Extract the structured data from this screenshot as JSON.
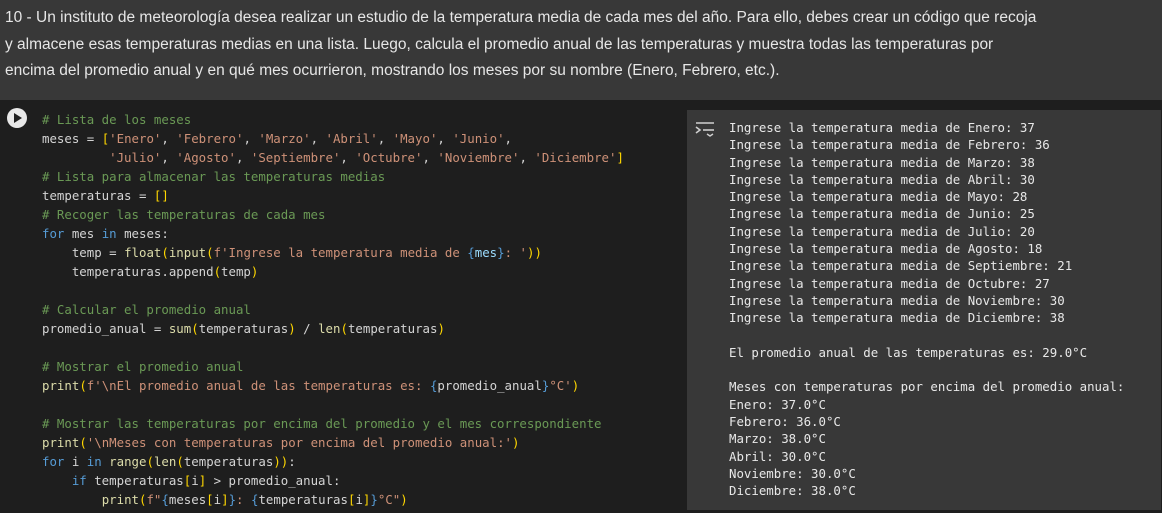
{
  "text_cell": {
    "content": "10 - Un instituto de meteorología desea realizar un estudio de la temperatura media de cada mes del año. Para ello, debes crear un código que recoja y almacene esas temperaturas medias en una lista. Luego, calcula el promedio anual de las temperaturas y muestra todas las temperaturas por encima del promedio anual y en qué mes ocurrieron, mostrando los meses por su nombre (Enero, Febrero, etc.)."
  },
  "code_cell": {
    "run_icon": "play-icon",
    "lines": [
      [
        {
          "t": "# Lista de los meses",
          "c": "c-com"
        }
      ],
      [
        {
          "t": "meses = "
        },
        {
          "t": "[",
          "c": "c-br"
        },
        {
          "t": "'Enero'",
          "c": "c-str"
        },
        {
          "t": ", "
        },
        {
          "t": "'Febrero'",
          "c": "c-str"
        },
        {
          "t": ", "
        },
        {
          "t": "'Marzo'",
          "c": "c-str"
        },
        {
          "t": ", "
        },
        {
          "t": "'Abril'",
          "c": "c-str"
        },
        {
          "t": ", "
        },
        {
          "t": "'Mayo'",
          "c": "c-str"
        },
        {
          "t": ", "
        },
        {
          "t": "'Junio'",
          "c": "c-str"
        },
        {
          "t": ","
        }
      ],
      [
        {
          "t": "         "
        },
        {
          "t": "'Julio'",
          "c": "c-str"
        },
        {
          "t": ", "
        },
        {
          "t": "'Agosto'",
          "c": "c-str"
        },
        {
          "t": ", "
        },
        {
          "t": "'Septiembre'",
          "c": "c-str"
        },
        {
          "t": ", "
        },
        {
          "t": "'Octubre'",
          "c": "c-str"
        },
        {
          "t": ", "
        },
        {
          "t": "'Noviembre'",
          "c": "c-str"
        },
        {
          "t": ", "
        },
        {
          "t": "'Diciembre'",
          "c": "c-str"
        },
        {
          "t": "]",
          "c": "c-br"
        }
      ],
      [
        {
          "t": "# Lista para almacenar las temperaturas medias",
          "c": "c-com"
        }
      ],
      [
        {
          "t": "temperaturas = "
        },
        {
          "t": "[]",
          "c": "c-br"
        }
      ],
      [
        {
          "t": "# Recoger las temperaturas de cada mes",
          "c": "c-com"
        }
      ],
      [
        {
          "t": "for",
          "c": "c-kw"
        },
        {
          "t": " mes "
        },
        {
          "t": "in",
          "c": "c-kw"
        },
        {
          "t": " meses:"
        }
      ],
      [
        {
          "t": "    temp = "
        },
        {
          "t": "float",
          "c": "c-fn"
        },
        {
          "t": "(",
          "c": "c-br"
        },
        {
          "t": "input",
          "c": "c-fn"
        },
        {
          "t": "(",
          "c": "c-br"
        },
        {
          "t": "f'Ingrese la temperatura media de ",
          "c": "c-str"
        },
        {
          "t": "{",
          "c": "c-kw"
        },
        {
          "t": "mes",
          "c": "c-var"
        },
        {
          "t": "}",
          "c": "c-kw"
        },
        {
          "t": ": '",
          "c": "c-str"
        },
        {
          "t": "))",
          "c": "c-br"
        }
      ],
      [
        {
          "t": "    temperaturas.append"
        },
        {
          "t": "(",
          "c": "c-br"
        },
        {
          "t": "temp"
        },
        {
          "t": ")",
          "c": "c-br"
        }
      ],
      [
        {
          "t": ""
        }
      ],
      [
        {
          "t": "# Calcular el promedio anual",
          "c": "c-com"
        }
      ],
      [
        {
          "t": "promedio_anual = "
        },
        {
          "t": "sum",
          "c": "c-fn"
        },
        {
          "t": "(",
          "c": "c-br"
        },
        {
          "t": "temperaturas"
        },
        {
          "t": ")",
          "c": "c-br"
        },
        {
          "t": " / "
        },
        {
          "t": "len",
          "c": "c-fn"
        },
        {
          "t": "(",
          "c": "c-br"
        },
        {
          "t": "temperaturas"
        },
        {
          "t": ")",
          "c": "c-br"
        }
      ],
      [
        {
          "t": ""
        }
      ],
      [
        {
          "t": "# Mostrar el promedio anual",
          "c": "c-com"
        }
      ],
      [
        {
          "t": "print",
          "c": "c-fn"
        },
        {
          "t": "(",
          "c": "c-br"
        },
        {
          "t": "f'\\nEl promedio anual de las temperaturas es: ",
          "c": "c-str"
        },
        {
          "t": "{",
          "c": "c-kw"
        },
        {
          "t": "promedio_anual"
        },
        {
          "t": "}",
          "c": "c-kw"
        },
        {
          "t": "°C'",
          "c": "c-str"
        },
        {
          "t": ")",
          "c": "c-br"
        }
      ],
      [
        {
          "t": ""
        }
      ],
      [
        {
          "t": "# Mostrar las temperaturas por encima del promedio y el mes correspondiente",
          "c": "c-com"
        }
      ],
      [
        {
          "t": "print",
          "c": "c-fn"
        },
        {
          "t": "(",
          "c": "c-br"
        },
        {
          "t": "'\\nMeses con temperaturas por encima del promedio anual:'",
          "c": "c-str"
        },
        {
          "t": ")",
          "c": "c-br"
        }
      ],
      [
        {
          "t": "for",
          "c": "c-kw"
        },
        {
          "t": " i "
        },
        {
          "t": "in",
          "c": "c-kw"
        },
        {
          "t": " "
        },
        {
          "t": "range",
          "c": "c-fn"
        },
        {
          "t": "(",
          "c": "c-br"
        },
        {
          "t": "len",
          "c": "c-fn"
        },
        {
          "t": "(",
          "c": "c-br"
        },
        {
          "t": "temperaturas"
        },
        {
          "t": "))",
          "c": "c-br"
        },
        {
          "t": ":"
        }
      ],
      [
        {
          "t": "    "
        },
        {
          "t": "if",
          "c": "c-kw"
        },
        {
          "t": " temperaturas"
        },
        {
          "t": "[",
          "c": "c-br"
        },
        {
          "t": "i"
        },
        {
          "t": "]",
          "c": "c-br"
        },
        {
          "t": " > promedio_anual:"
        }
      ],
      [
        {
          "t": "        "
        },
        {
          "t": "print",
          "c": "c-fn"
        },
        {
          "t": "(",
          "c": "c-br"
        },
        {
          "t": "f\"",
          "c": "c-str"
        },
        {
          "t": "{",
          "c": "c-kw"
        },
        {
          "t": "meses"
        },
        {
          "t": "[",
          "c": "c-br"
        },
        {
          "t": "i"
        },
        {
          "t": "]",
          "c": "c-br"
        },
        {
          "t": "}",
          "c": "c-kw"
        },
        {
          "t": ": ",
          "c": "c-str"
        },
        {
          "t": "{",
          "c": "c-kw"
        },
        {
          "t": "temperaturas"
        },
        {
          "t": "[",
          "c": "c-br"
        },
        {
          "t": "i"
        },
        {
          "t": "]",
          "c": "c-br"
        },
        {
          "t": "}",
          "c": "c-kw"
        },
        {
          "t": "°C\"",
          "c": "c-str"
        },
        {
          "t": ")",
          "c": "c-br"
        }
      ]
    ]
  },
  "output": {
    "icon": "output-expand-icon",
    "lines": [
      "Ingrese la temperatura media de Enero: 37",
      "Ingrese la temperatura media de Febrero: 36",
      "Ingrese la temperatura media de Marzo: 38",
      "Ingrese la temperatura media de Abril: 30",
      "Ingrese la temperatura media de Mayo: 28",
      "Ingrese la temperatura media de Junio: 25",
      "Ingrese la temperatura media de Julio: 20",
      "Ingrese la temperatura media de Agosto: 18",
      "Ingrese la temperatura media de Septiembre: 21",
      "Ingrese la temperatura media de Octubre: 27",
      "Ingrese la temperatura media de Noviembre: 30",
      "Ingrese la temperatura media de Diciembre: 38",
      "",
      "El promedio anual de las temperaturas es: 29.0°C",
      "",
      "Meses con temperaturas por encima del promedio anual:",
      "Enero: 37.0°C",
      "Febrero: 36.0°C",
      "Marzo: 38.0°C",
      "Abril: 30.0°C",
      "Noviembre: 30.0°C",
      "Diciembre: 38.0°C"
    ]
  }
}
